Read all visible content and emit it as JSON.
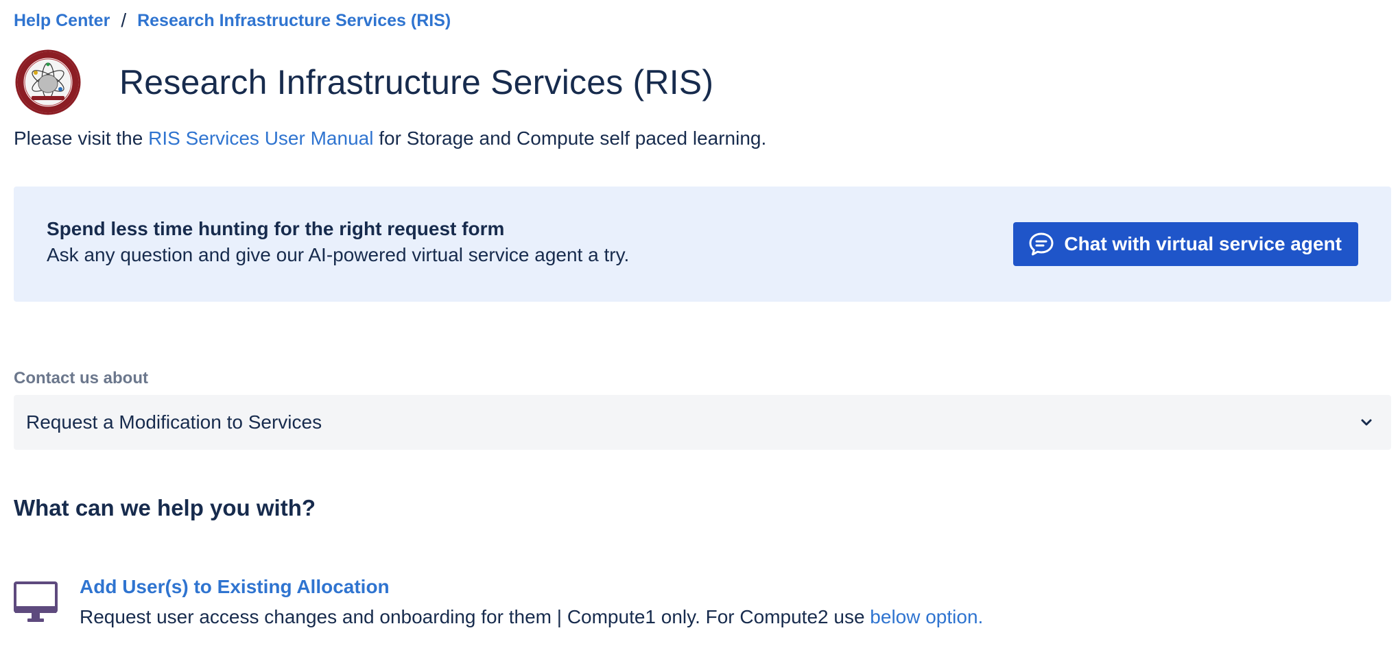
{
  "breadcrumb": {
    "home": "Help Center",
    "separator": "/",
    "current": "Research Infrastructure Services (RIS)"
  },
  "header": {
    "title": "Research Infrastructure Services (RIS)",
    "logo_icon": "ris-logo-seal"
  },
  "intro": {
    "prefix": "Please visit the ",
    "link": "RIS Services User Manual",
    "suffix": " for Storage and Compute self paced learning."
  },
  "banner": {
    "title": "Spend less time hunting for the right request form",
    "description": "Ask any question and give our AI-powered virtual service agent a try.",
    "button_label": "Chat with virtual service agent",
    "button_icon": "chat-bubble-icon"
  },
  "contact": {
    "label": "Contact us about",
    "selected": "Request a Modification to Services"
  },
  "help": {
    "heading": "What can we help you with?",
    "options": [
      {
        "icon": "monitor-icon",
        "title": "Add User(s) to Existing Allocation",
        "description": "Request user access changes and onboarding for them | Compute1 only. For Compute2 use ",
        "link": "below option."
      }
    ]
  },
  "colors": {
    "link": "#2f74d0",
    "text": "#172b4d",
    "banner_bg": "#e9f0fc",
    "button_bg": "#1f55c9",
    "select_bg": "#f4f5f7",
    "icon_purple": "#5e4a7e"
  }
}
